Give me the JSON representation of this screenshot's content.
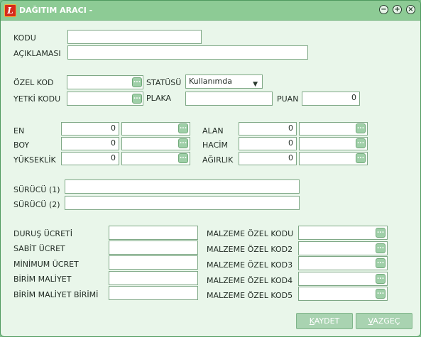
{
  "window": {
    "title": "DAĞITIM ARACI -",
    "app_icon_letter": "L"
  },
  "labels": {
    "kodu": "KODU",
    "aciklamasi": "AÇIKLAMASI",
    "ozel_kod": "ÖZEL KOD",
    "statusu": "STATÜSÜ",
    "yetki_kodu": "YETKİ KODU",
    "plaka": "PLAKA",
    "puan": "PUAN",
    "en": "EN",
    "boy": "BOY",
    "yukseklik": "YÜKSEKLİK",
    "alan": "ALAN",
    "hacim": "HACİM",
    "agirlik": "AĞIRLIK",
    "surucu1": "SÜRÜCÜ (1)",
    "surucu2": "SÜRÜCÜ (2)",
    "durus_ucreti": "DURUŞ ÜCRETİ",
    "sabit_ucret": "SABİT ÜCRET",
    "minimum_ucret": "MİNİMUM ÜCRET",
    "birim_maliyet": "BİRİM MALİYET",
    "birim_maliyet_birimi": "BİRİM MALİYET BİRİMİ",
    "malzeme_ozel_kodu": "MALZEME ÖZEL KODU",
    "malzeme_ozel_kod2": "MALZEME ÖZEL KOD2",
    "malzeme_ozel_kod3": "MALZEME ÖZEL KOD3",
    "malzeme_ozel_kod4": "MALZEME ÖZEL KOD4",
    "malzeme_ozel_kod5": "MALZEME ÖZEL KOD5"
  },
  "values": {
    "kodu": "",
    "aciklamasi": "",
    "ozel_kod": "",
    "statusu": "Kullanımda",
    "yetki_kodu": "",
    "plaka": "",
    "puan": "0",
    "en": "0",
    "boy": "0",
    "yukseklik": "0",
    "alan": "0",
    "hacim": "0",
    "agirlik": "0",
    "surucu1": "",
    "surucu2": ""
  },
  "lookup_button": "...",
  "buttons": {
    "save_first": "K",
    "save_rest": "AYDET",
    "cancel_first": "V",
    "cancel_rest": "AZGEÇ"
  }
}
